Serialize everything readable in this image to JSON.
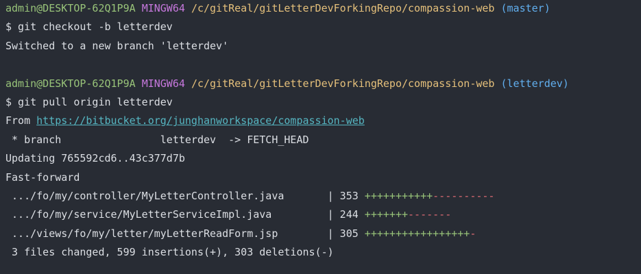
{
  "prompt1": {
    "user_host": "admin@DESKTOP-62Q1P9A",
    "env": "MINGW64",
    "path": "/c/gitReal/gitLetterDevForkingRepo/compassion-web",
    "branch": "(master)"
  },
  "cmd1": "$ git checkout -b letterdev",
  "out1": "Switched to a new branch 'letterdev'",
  "prompt2": {
    "user_host": "admin@DESKTOP-62Q1P9A",
    "env": "MINGW64",
    "path": "/c/gitReal/gitLetterDevForkingRepo/compassion-web",
    "branch": "(letterdev)"
  },
  "cmd2": "$ git pull origin letterdev",
  "from": {
    "label": "From ",
    "url": "https://bitbucket.org/junghanworkspace/compassion-web"
  },
  "branch_line": " * branch                letterdev  -> FETCH_HEAD",
  "updating": "Updating 765592cd6..43c377d7b",
  "fast_forward": "Fast-forward",
  "files": [
    {
      "name": " .../fo/my/controller/MyLetterController.java       | 353 ",
      "plus": "+++++++++++",
      "minus": "----------"
    },
    {
      "name": " .../fo/my/service/MyLetterServiceImpl.java         | 244 ",
      "plus": "+++++++",
      "minus": "-------"
    },
    {
      "name": " .../views/fo/my/letter/myLetterReadForm.jsp        | 305 ",
      "plus": "+++++++++++++++++",
      "minus": "-"
    }
  ],
  "summary": " 3 files changed, 599 insertions(+), 303 deletions(-)",
  "colors": {
    "background": "#282c34",
    "text": "#dcdfe4",
    "user": "#98c379",
    "env": "#c678dd",
    "path": "#e5c07b",
    "branch": "#61afef",
    "url": "#56b6c2",
    "plus": "#98c379",
    "minus": "#e06c75"
  }
}
